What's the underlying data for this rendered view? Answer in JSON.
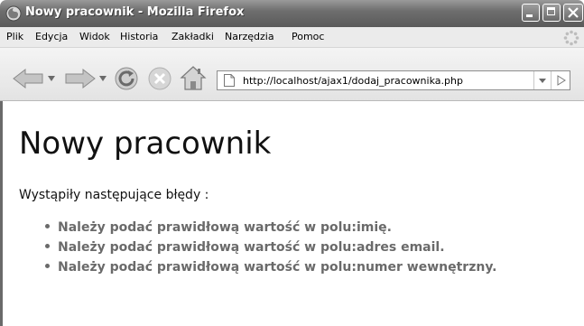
{
  "window": {
    "title": "Nowy pracownik - Mozilla Firefox"
  },
  "menu": {
    "items": [
      "Plik",
      "Edycja",
      "Widok",
      "Historia",
      "Zakładki",
      "Narzędzia",
      "Pomoc"
    ]
  },
  "toolbar": {
    "url": "http://localhost/ajax1/dodaj_pracownika.php"
  },
  "page": {
    "heading": "Nowy pracownik",
    "intro": "Wystąpiły następujące błędy :",
    "errors": [
      "Należy podać prawidłową wartość w polu:imię.",
      "Należy podać prawidłową wartość w polu:adres email.",
      "Należy podać prawidłową wartość w polu:numer wewnętrzny."
    ]
  },
  "icons": {
    "app": "firefox-icon",
    "back": "back-arrow-icon",
    "forward": "forward-arrow-icon",
    "reload": "reload-icon",
    "stop": "stop-icon",
    "home": "home-icon",
    "page": "page-icon",
    "throbber": "throbber-icon"
  }
}
